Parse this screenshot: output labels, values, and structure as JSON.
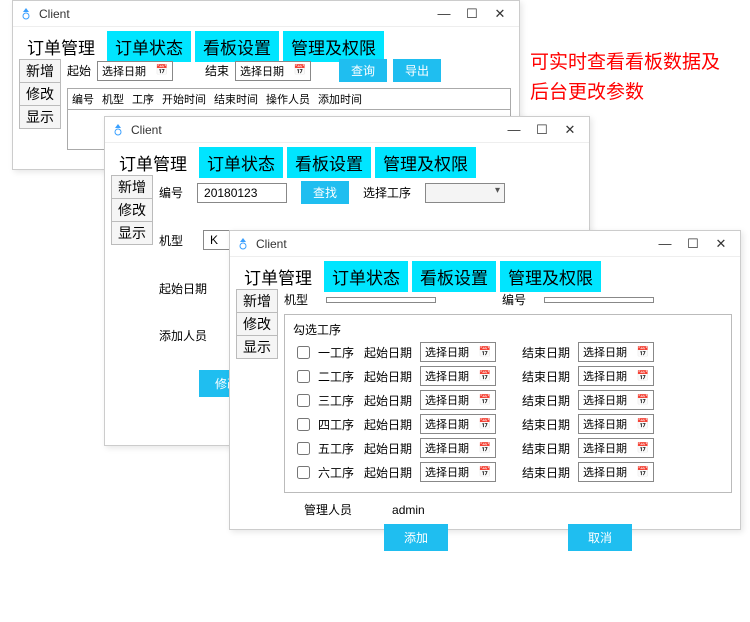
{
  "annotation": "可实时查看看板数据及后台更改参数",
  "app_title": "Client",
  "win_controls": {
    "min": "—",
    "max": "☐",
    "close": "✕"
  },
  "tabs": [
    "订单管理",
    "订单状态",
    "看板设置",
    "管理及权限"
  ],
  "sidebar": [
    "新增",
    "修改",
    "显示"
  ],
  "w1": {
    "filter": {
      "start_lbl": "起始",
      "end_lbl": "结束",
      "date_placeholder": "选择日期",
      "search_btn": "查询",
      "export_btn": "导出"
    },
    "columns": [
      "编号",
      "机型",
      "工序",
      "开始时间",
      "结束时间",
      "操作人员",
      "添加时间"
    ]
  },
  "w2": {
    "id_lbl": "编号",
    "id_value": "20180123",
    "find_btn": "查找",
    "proc_lbl": "选择工序",
    "model_lbl": "机型",
    "model_value": "K",
    "startdate_lbl": "起始日期",
    "people_lbl": "添加人员",
    "submit_btn": "修改信息"
  },
  "w3": {
    "model_lbl": "机型",
    "id_lbl": "编号",
    "fieldset_lbl": "勾选工序",
    "processes": [
      "一工序",
      "二工序",
      "三工序",
      "四工序",
      "五工序",
      "六工序"
    ],
    "start_lbl": "起始日期",
    "end_lbl": "结束日期",
    "date_placeholder": "选择日期",
    "admin_lbl": "管理人员",
    "admin_value": "admin",
    "add_btn": "添加",
    "cancel_btn": "取消"
  }
}
